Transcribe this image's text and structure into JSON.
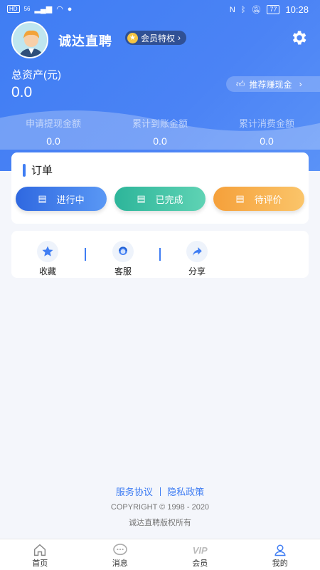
{
  "status_bar": {
    "network_left": "HD",
    "signal": "56",
    "time": "10:28",
    "battery": "77"
  },
  "profile": {
    "app_name": "诚达直聘",
    "member_badge": "会员特权"
  },
  "assets": {
    "label": "总资产(元)",
    "value": "0.0",
    "recommend": "推荐赚现金"
  },
  "stats": [
    {
      "label": "申请提现金额",
      "value": "0.0"
    },
    {
      "label": "累计到账金额",
      "value": "0.0"
    },
    {
      "label": "累计消费金额",
      "value": "0.0"
    }
  ],
  "orders": {
    "title": "订单",
    "buttons": [
      {
        "label": "进行中"
      },
      {
        "label": "已完成"
      },
      {
        "label": "待评价"
      }
    ]
  },
  "actions": [
    {
      "label": "收藏",
      "icon": "star-icon"
    },
    {
      "label": "客服",
      "icon": "support-icon"
    },
    {
      "label": "分享",
      "icon": "share-icon"
    }
  ],
  "footer": {
    "service_agreement": "服务协议",
    "privacy_policy": "隐私政策",
    "copyright": "COPYRIGHT © 1998 - 2020",
    "rights": "诚达直聘版权所有"
  },
  "tabbar": [
    {
      "label": "首页",
      "icon": "home-icon"
    },
    {
      "label": "消息",
      "icon": "message-icon"
    },
    {
      "label": "会员",
      "icon": "vip-icon"
    },
    {
      "label": "我的",
      "icon": "user-icon",
      "active": true
    }
  ],
  "colors": {
    "primary": "#3f7df3",
    "progress": "#2f68e0",
    "done": "#2db59a",
    "review": "#f5a03a"
  }
}
